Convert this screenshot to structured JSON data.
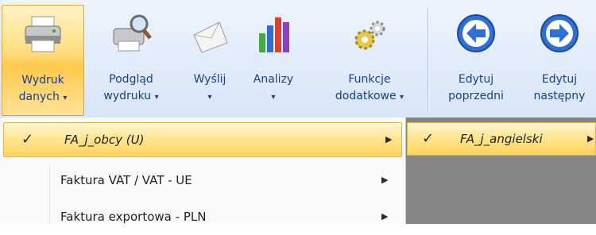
{
  "ribbon": {
    "buttons": [
      {
        "icon": "printer-icon",
        "line1": "Wydruk",
        "line2": "danych",
        "arrow": "▾",
        "highlighted": true
      },
      {
        "icon": "print-preview-icon",
        "line1": "Podgląd",
        "line2": "wydruku",
        "arrow": "▾"
      },
      {
        "icon": "envelope-icon",
        "line1": "Wyślij",
        "line2": "",
        "arrow": "▾"
      },
      {
        "icon": "bar-chart-icon",
        "line1": "Analizy",
        "line2": "",
        "arrow": "▾"
      },
      {
        "icon": "gears-icon",
        "line1": "Funkcje",
        "line2": "dodatkowe",
        "arrow": "▾"
      },
      {
        "icon": "arrow-left-circle-icon",
        "line1": "Edytuj",
        "line2": "poprzedni",
        "arrow": ""
      },
      {
        "icon": "arrow-right-circle-icon",
        "line1": "Edytuj",
        "line2": "następny",
        "arrow": ""
      }
    ]
  },
  "menu": {
    "items": [
      {
        "label": "FA_j_obcy (U)",
        "checked": true,
        "check_mark": "✓",
        "submenu_arrow": "▶"
      },
      {
        "label": "Faktura VAT / VAT - UE",
        "checked": false,
        "submenu_arrow": "▶"
      },
      {
        "label": "Faktura exportowa - PLN",
        "checked": false,
        "submenu_arrow": "▶"
      }
    ]
  },
  "submenu": {
    "items": [
      {
        "label": "FA_j_angielski",
        "checked": true,
        "check_mark": "✓",
        "submenu_arrow": "▶"
      }
    ]
  },
  "colors": {
    "ribbon_text": "#15428b",
    "highlight": "#ffd35c",
    "overlay_grey": "#858585"
  }
}
